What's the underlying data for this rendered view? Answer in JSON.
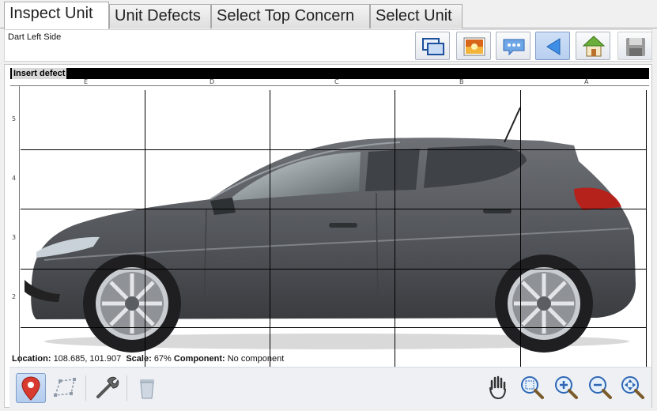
{
  "tabs": [
    {
      "label": "Inspect Unit",
      "active": true
    },
    {
      "label": "Unit Defects",
      "active": false
    },
    {
      "label": "Select Top Concern",
      "active": false
    },
    {
      "label": "Select Unit",
      "active": false
    }
  ],
  "header": {
    "title": "Dart Left Side",
    "toolbar_icons": [
      "switch-windows-icon",
      "image-icon",
      "comment-icon",
      "back-arrow-icon",
      "home-icon",
      "save-icon"
    ]
  },
  "canvas": {
    "insert_label": "Insert defect",
    "columns": [
      "E",
      "D",
      "C",
      "B",
      "A"
    ],
    "rows": [
      "5",
      "4",
      "3",
      "2"
    ]
  },
  "status": {
    "location_label": "Location:",
    "location_value": "108.685, 101.907",
    "scale_label": "Scale:",
    "scale_value": "67%",
    "component_label": "Component:",
    "component_value": "No component"
  },
  "tools": {
    "left": [
      "pin-icon",
      "polygon-icon",
      "wrench-icon",
      "trash-icon"
    ],
    "right": [
      "hand-icon",
      "zoom-fit-icon",
      "zoom-in-icon",
      "zoom-out-icon",
      "zoom-all-icon"
    ]
  },
  "colors": {
    "car_body": "#55585d",
    "active_tool": "#b7cfef",
    "pin": "#d93a2f"
  }
}
